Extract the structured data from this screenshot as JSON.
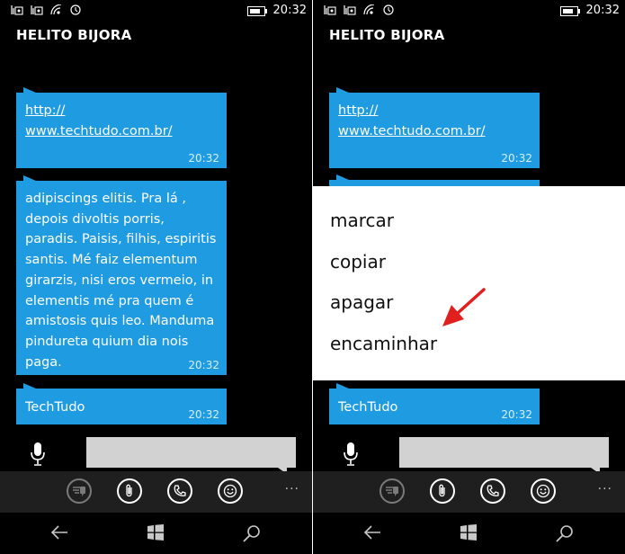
{
  "status": {
    "time": "20:32"
  },
  "contact": {
    "name": "HELITO BIJORA"
  },
  "messages": {
    "link_line1": "http://",
    "link_line2": "www.techtudo.com.br/",
    "link_time": "20:32",
    "long_lines": [
      "adipiscings elitis. Pra lá ,",
      "depois divoltis porris,",
      "paradis. Paisis, filhis, espiritis",
      "santis. Mé faiz elementum",
      "girarzis, nisi eros vermeio, in",
      "elementis mé pra quem é",
      "amistosis quis leo. Manduma",
      "pindureta quium dia nois",
      "paga."
    ],
    "long_time": "20:32",
    "short_text": "TechTudo",
    "short_time": "20:32"
  },
  "context_menu": {
    "items": [
      "marcar",
      "copiar",
      "apagar",
      "encaminhar"
    ]
  },
  "appbar": {
    "more": "···"
  },
  "colors": {
    "bubble": "#1e9be1",
    "background": "#000000",
    "menu": "#ffffff",
    "arrow": "#e0201f"
  },
  "icons": [
    "speech-to-text-icon",
    "attach-icon",
    "call-icon",
    "emoji-icon",
    "back-icon",
    "windows-icon",
    "search-icon",
    "microphone-icon"
  ]
}
